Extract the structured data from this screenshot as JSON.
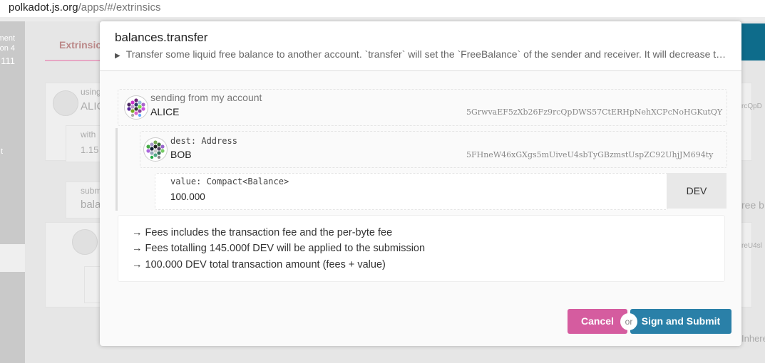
{
  "browser": {
    "host": "polkadot.js.org",
    "path": "/apps/#/extrinsics"
  },
  "background": {
    "side_text_1": "ement",
    "side_text_2": "on 4",
    "side_text_3": "111",
    "side_text_4": "t",
    "tab_label": "Extrinsic",
    "using_label": "using",
    "using_value": "ALIC",
    "with_label": "with",
    "with_value": "1.15",
    "submit_label": "subm",
    "submit_value": "bala",
    "right_addr_1": "rcQpD",
    "right_text_2": "ree b",
    "right_addr_3": "reU4sl",
    "right_text_4": "Inhere"
  },
  "modal": {
    "title": "balances.transfer",
    "description": "Transfer some liquid free balance to another account. `transfer` will set the `FreeBalance` of the sender and receiver. It will decrease the total issuance of the system by the `TransferFee`.",
    "sender": {
      "label": "sending from my account",
      "name": "ALICE",
      "address": "5GrwvaEF5zXb26Fz9rcQpDWS57CtERHpNehXCPcNoHGKutQY"
    },
    "dest": {
      "label": "dest: Address",
      "name": "BOB",
      "address": "5FHneW46xGXgs5mUiveU4sbTyGBzmstUspZC92UhjJM694ty"
    },
    "value": {
      "label": "value: Compact<Balance>",
      "amount": "100.000",
      "unit": "DEV"
    },
    "fees": [
      "→ Fees includes the transaction fee and the per-byte fee",
      "→ Fees totalling 145.000f DEV will be applied to the submission",
      "→ 100.000 DEV total transaction amount (fees + value)"
    ],
    "cancel_label": "Cancel",
    "or_label": "or",
    "sign_label": "Sign and Submit"
  }
}
